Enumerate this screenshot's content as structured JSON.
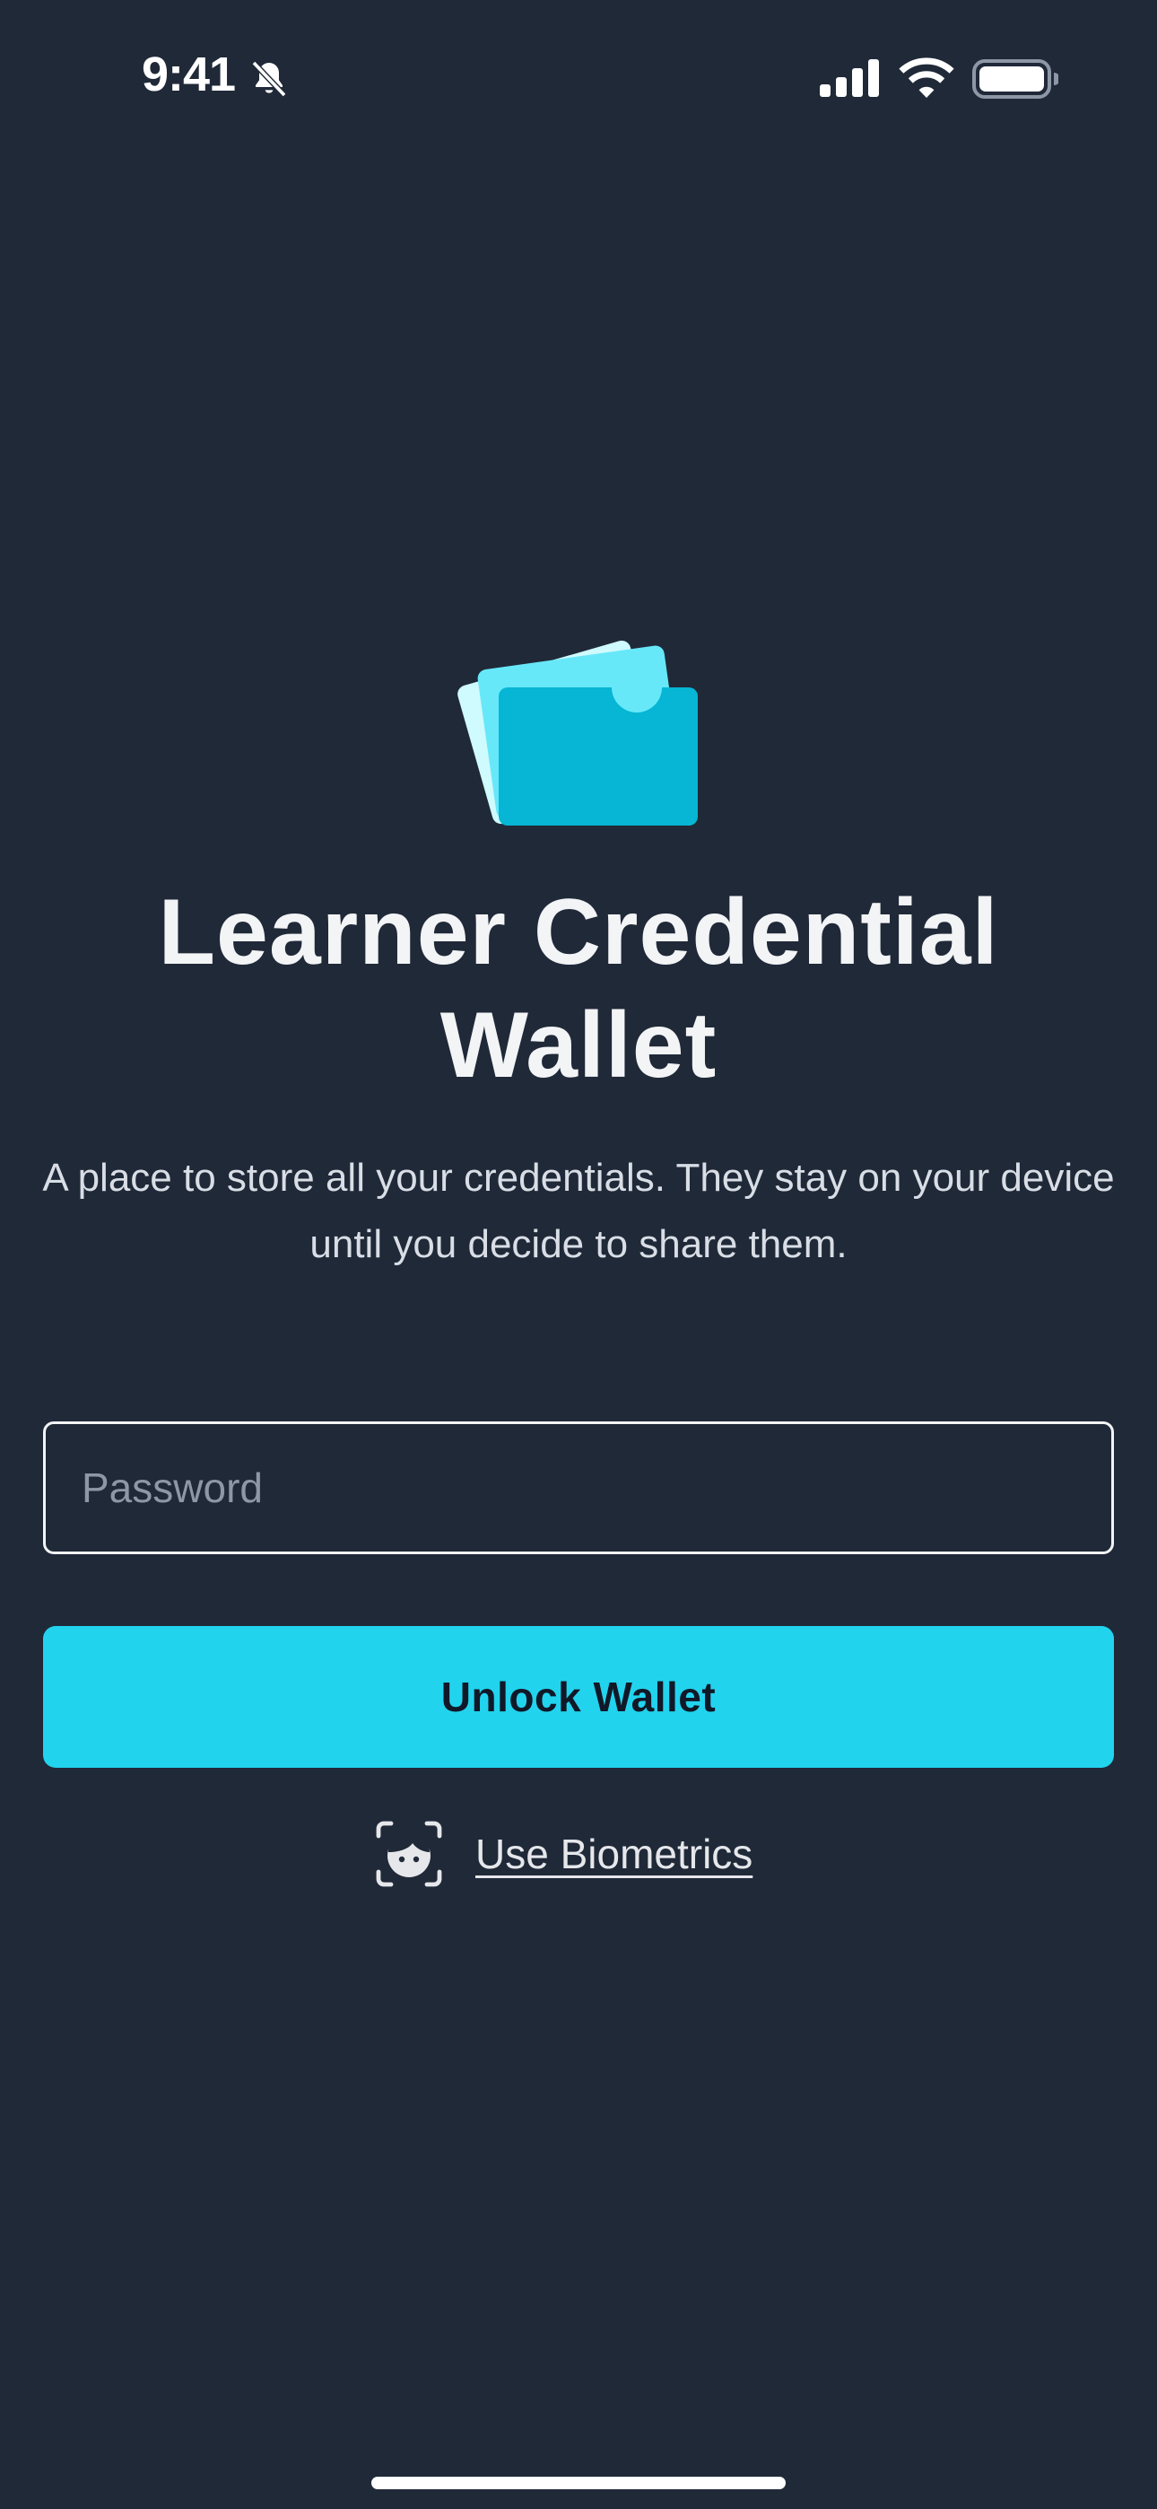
{
  "status_bar": {
    "time": "9:41",
    "icons": [
      "bell-slash-icon",
      "cellular-signal-icon",
      "wifi-icon",
      "battery-icon"
    ]
  },
  "app": {
    "logo_icon": "wallet-cards-icon",
    "title": "Learner Credential Wallet",
    "subtitle": "A place to store all your credentials. They stay on your device until you decide to share them."
  },
  "form": {
    "password_placeholder": "Password",
    "password_value": "",
    "unlock_label": "Unlock Wallet",
    "biometrics_icon": "face-id-icon",
    "biometrics_label": "Use Biometrics"
  },
  "colors": {
    "background": "#202938",
    "accent": "#22D3EE",
    "button_text": "#111827",
    "logo_light": "#CFFAFE",
    "logo_mid": "#67E8F9",
    "logo_dark": "#06B6D4"
  }
}
